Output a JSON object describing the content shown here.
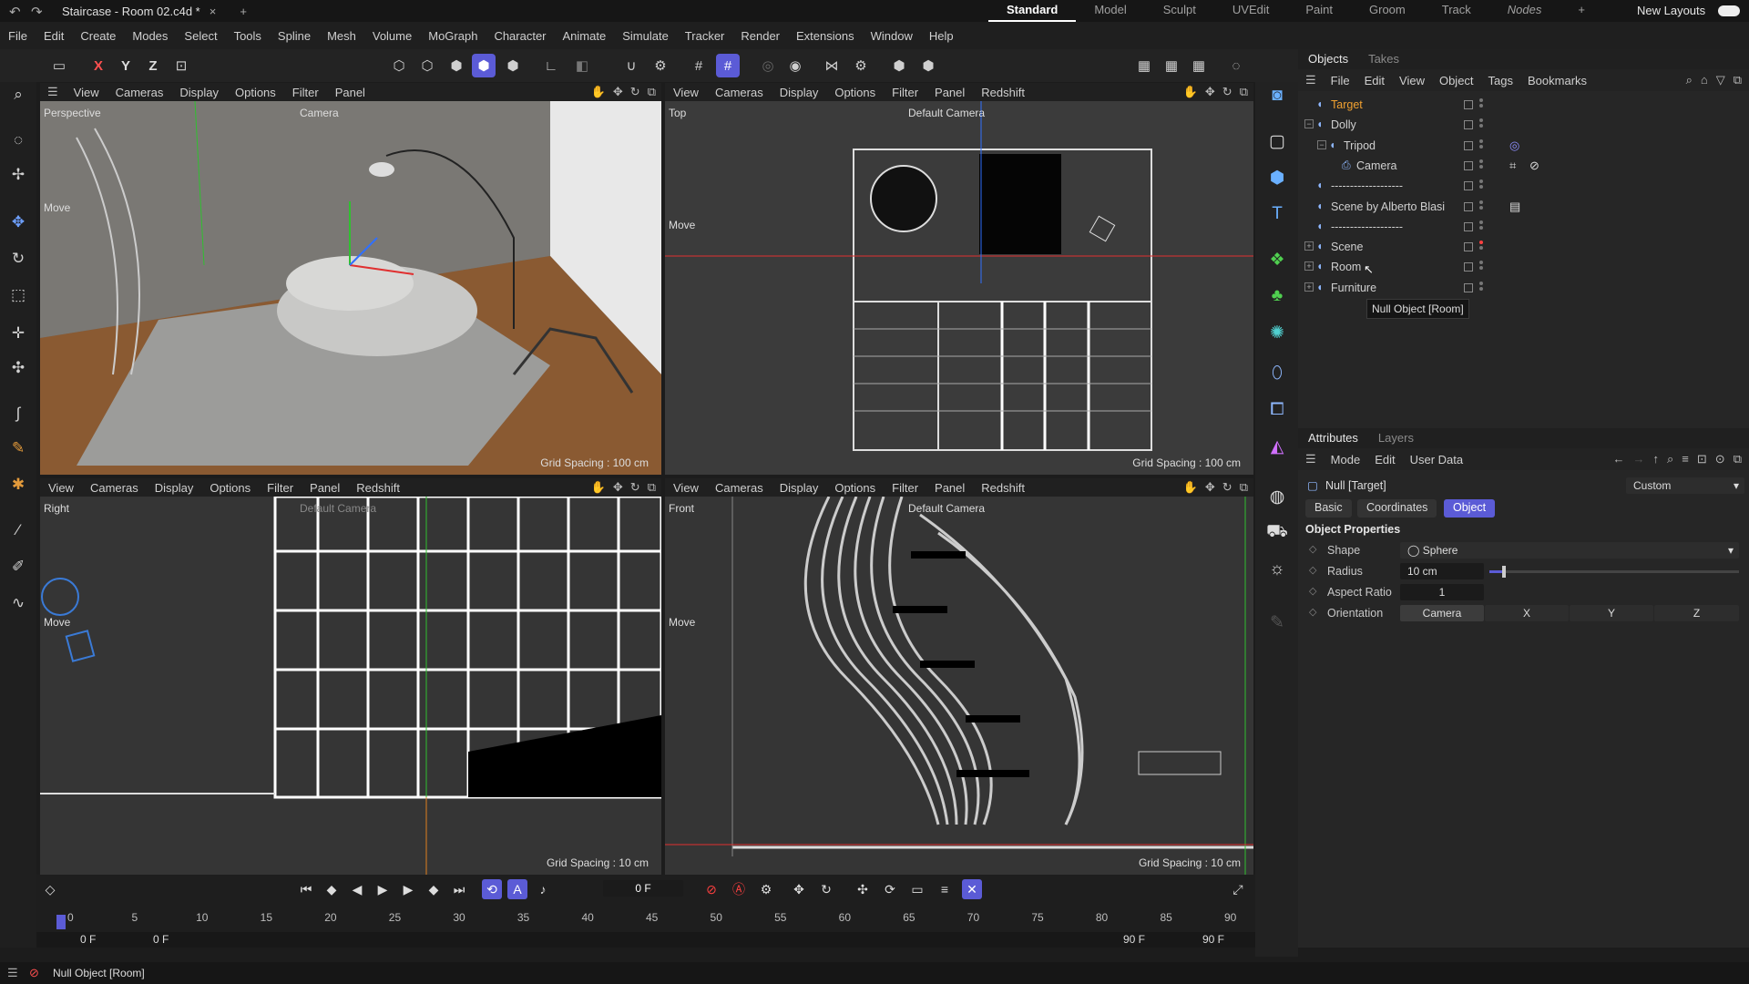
{
  "titlebar": {
    "doc_title": "Staircase - Room 02.c4d *",
    "close_glyph": "×",
    "add_glyph": "+",
    "layouts": [
      "Standard",
      "Model",
      "Sculpt",
      "UVEdit",
      "Paint",
      "Groom",
      "Track",
      "Nodes"
    ],
    "active_layout": "Standard",
    "add_layout_glyph": "+",
    "new_layouts": "New Layouts"
  },
  "menubar": [
    "File",
    "Edit",
    "Create",
    "Modes",
    "Select",
    "Tools",
    "Spline",
    "Mesh",
    "Volume",
    "MoGraph",
    "Character",
    "Animate",
    "Simulate",
    "Tracker",
    "Render",
    "Extensions",
    "Window",
    "Help"
  ],
  "toolbar": {
    "axis_x": "X",
    "axis_y": "Y",
    "axis_z": "Z"
  },
  "viewports": {
    "perspective": {
      "menu": [
        "View",
        "Cameras",
        "Display",
        "Options",
        "Filter",
        "Panel"
      ],
      "label": "Perspective",
      "camera": "Camera",
      "grid": "Grid Spacing : 100 cm",
      "move": "Move"
    },
    "top": {
      "menu": [
        "View",
        "Cameras",
        "Display",
        "Options",
        "Filter",
        "Panel",
        "Redshift"
      ],
      "label": "Top",
      "camera": "Default Camera",
      "grid": "Grid Spacing : 100 cm",
      "move": "Move"
    },
    "right": {
      "menu": [
        "View",
        "Cameras",
        "Display",
        "Options",
        "Filter",
        "Panel",
        "Redshift"
      ],
      "label": "Right",
      "camera": "Default Camera",
      "grid": "Grid Spacing : 10 cm",
      "move": "Move"
    },
    "front": {
      "menu": [
        "View",
        "Cameras",
        "Display",
        "Options",
        "Filter",
        "Panel",
        "Redshift"
      ],
      "label": "Front",
      "camera": "Default Camera",
      "grid": "Grid Spacing : 10 cm",
      "move": "Move"
    }
  },
  "objects_panel": {
    "tabs": [
      "Objects",
      "Takes"
    ],
    "menu": [
      "File",
      "Edit",
      "View",
      "Object",
      "Tags",
      "Bookmarks"
    ],
    "rows": [
      {
        "name": "Target",
        "depth": 0,
        "expander": "",
        "color": "#f0a030"
      },
      {
        "name": "Dolly",
        "depth": 0,
        "expander": "−",
        "color": "#d0d0d0"
      },
      {
        "name": "Tripod",
        "depth": 1,
        "expander": "−",
        "color": "#d0d0d0"
      },
      {
        "name": "Camera",
        "depth": 2,
        "expander": "",
        "color": "#d0d0d0"
      },
      {
        "name": "-------------------",
        "depth": 0,
        "expander": "",
        "color": "#d0d0d0"
      },
      {
        "name": "Scene by Alberto Blasi",
        "depth": 0,
        "expander": "",
        "color": "#d0d0d0"
      },
      {
        "name": "-------------------",
        "depth": 0,
        "expander": "",
        "color": "#d0d0d0"
      },
      {
        "name": "Scene",
        "depth": 0,
        "expander": "+",
        "color": "#d0d0d0"
      },
      {
        "name": "Room",
        "depth": 0,
        "expander": "+",
        "color": "#d0d0d0"
      },
      {
        "name": "Furniture",
        "depth": 0,
        "expander": "+",
        "color": "#d0d0d0"
      }
    ],
    "tooltip": "Null Object [Room]"
  },
  "attributes_panel": {
    "tabs": [
      "Attributes",
      "Layers"
    ],
    "menu": [
      "Mode",
      "Edit",
      "User Data"
    ],
    "object_title": "Null [Target]",
    "preset": "Custom",
    "subtabs": [
      "Basic",
      "Coordinates",
      "Object"
    ],
    "active_subtab": "Object",
    "section": "Object Properties",
    "props": {
      "shape_label": "Shape",
      "shape_value": "Sphere",
      "radius_label": "Radius",
      "radius_value": "10 cm",
      "radius_slider": 0.05,
      "aspect_label": "Aspect Ratio",
      "aspect_value": "1",
      "orientation_label": "Orientation",
      "orientation_options": [
        "Camera",
        "X",
        "Y",
        "Z"
      ],
      "orientation_selected": "Camera"
    }
  },
  "timeline": {
    "current_frame": "0 F",
    "ticks": [
      "0",
      "5",
      "10",
      "15",
      "20",
      "25",
      "30",
      "35",
      "40",
      "45",
      "50",
      "55",
      "60",
      "65",
      "70",
      "75",
      "80",
      "85",
      "90"
    ],
    "start_a": "0 F",
    "start_b": "0 F",
    "end_a": "90 F",
    "end_b": "90 F"
  },
  "statusbar": {
    "message": "Null Object [Room]"
  },
  "colors": {
    "accent": "#5b5bd6",
    "axis_x": "#e03030",
    "axis_y": "#30c030",
    "axis_z": "#3070ff",
    "selected_object": "#f0a030"
  }
}
